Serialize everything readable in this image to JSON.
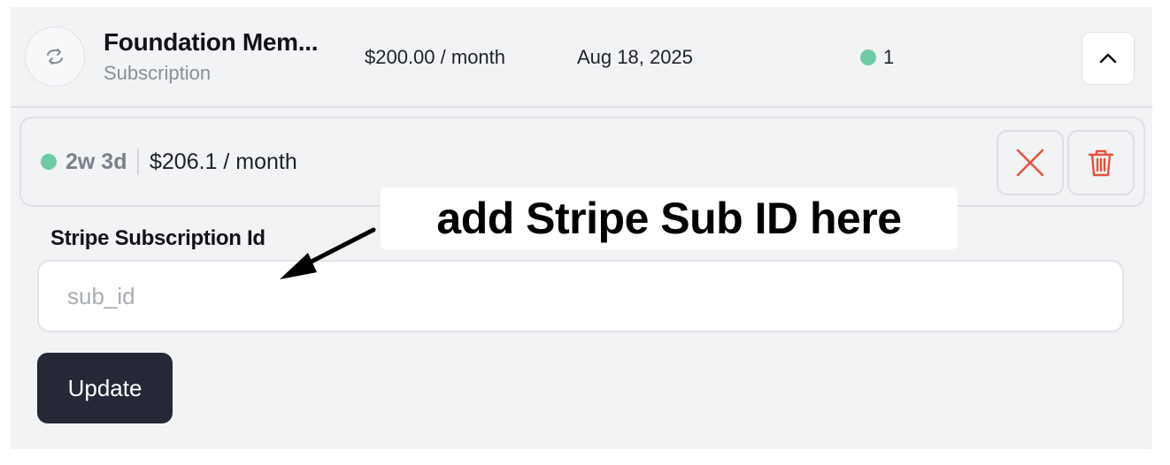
{
  "subscription": {
    "title": "Foundation Mem...",
    "type": "Subscription",
    "price": "$200.00 / month",
    "date": "Aug 18, 2025",
    "count": "1",
    "icon": "refresh-icon",
    "collapse_icon": "chevron-up-icon"
  },
  "item": {
    "age": "2w 3d",
    "amount": "$206.1 / month",
    "cancel_icon": "close-icon",
    "delete_icon": "trash-icon"
  },
  "form": {
    "label": "Stripe Subscription Id",
    "placeholder": "sub_id",
    "value": "",
    "submit_label": "Update"
  },
  "annotation": {
    "text": "add Stripe Sub ID here"
  },
  "colors": {
    "status_dot": "#6fcba5",
    "danger": "#e5533f",
    "primary_button": "#252836",
    "panel_bg": "#f2f3f5"
  }
}
